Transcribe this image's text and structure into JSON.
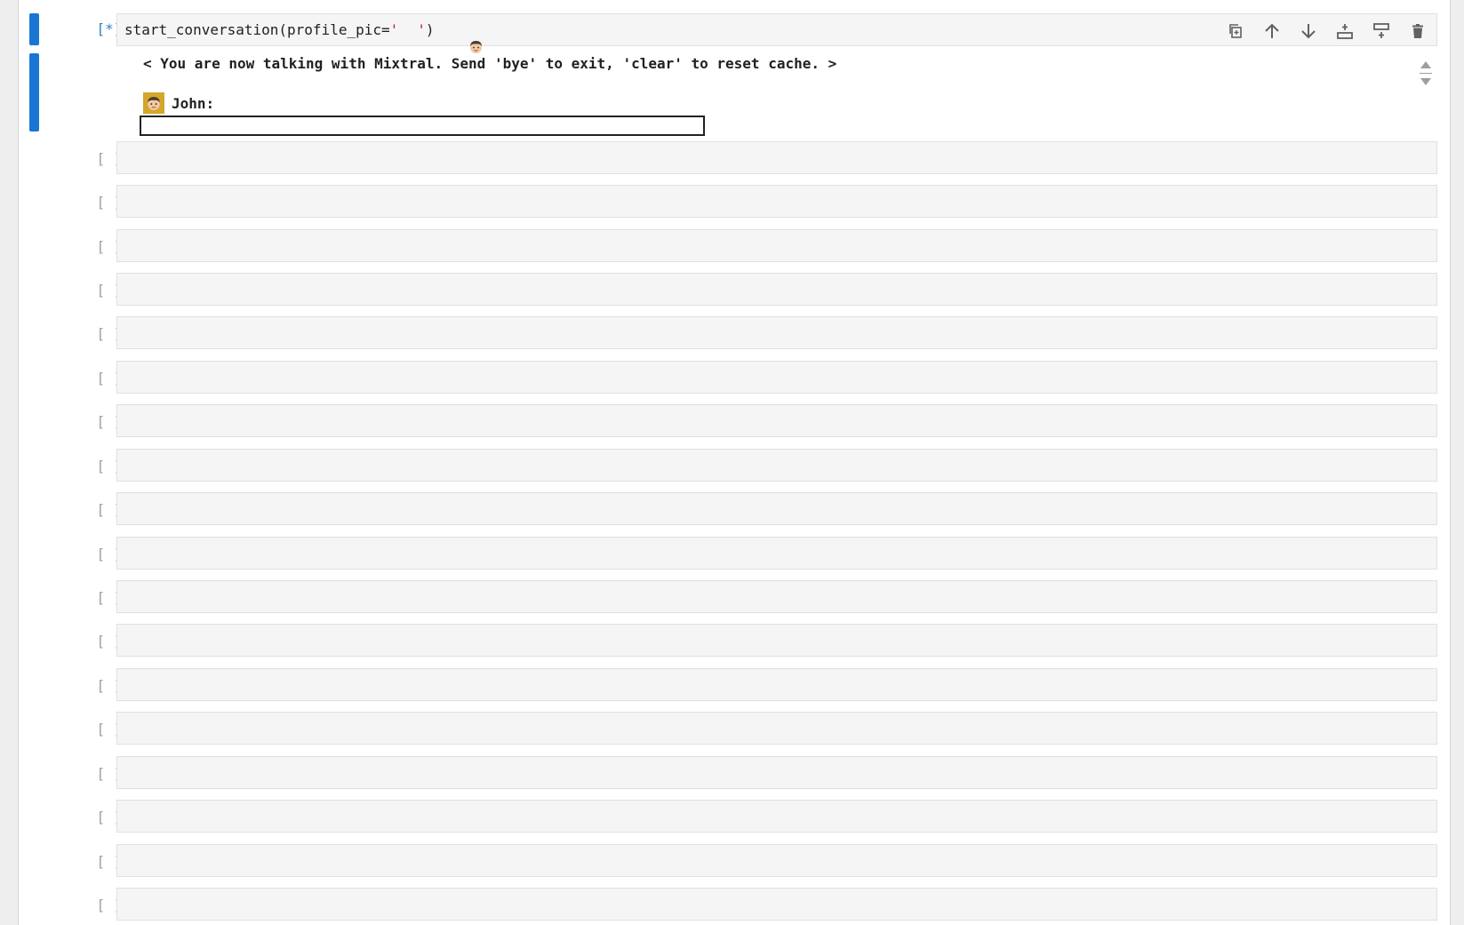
{
  "cells": [
    {
      "prompt": "[*]:",
      "state": "running",
      "code_prefix": "start_conversation(profile_pic=",
      "code_string_open": "'",
      "code_string_close": "'",
      "code_suffix": ")",
      "profile_pic_icon": "boy-face-emoji"
    }
  ],
  "toolbar": {
    "icons": [
      "duplicate-icon",
      "move-up-icon",
      "move-down-icon",
      "insert-below-icon",
      "insert-above-icon",
      "delete-icon"
    ]
  },
  "output": {
    "banner": "< You are now talking with Mixtral. Send 'bye' to exit, 'clear' to reset cache. >",
    "speaker_label": "John:",
    "chat_input_value": ""
  },
  "empty_prompt": "[ ]:",
  "colors": {
    "active_bar": "#1976d2",
    "cell_bg": "#f5f5f5",
    "running_prompt": "#307fc1",
    "idle_prompt": "#9e9e9e",
    "avatar_bg": "#d4a62a"
  }
}
